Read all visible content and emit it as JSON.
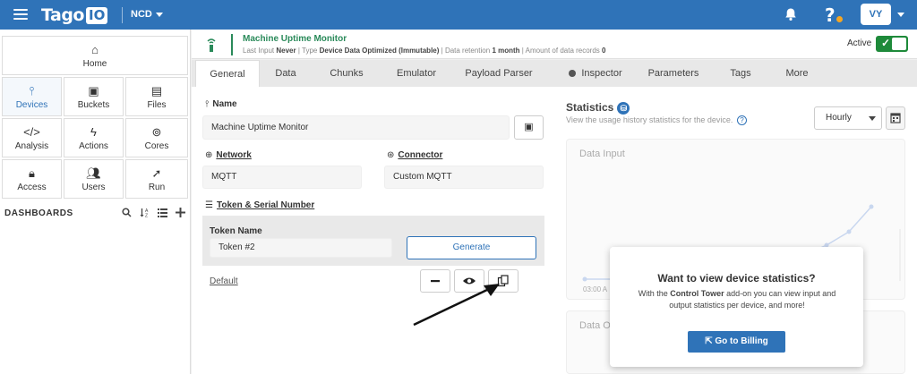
{
  "topbar": {
    "logo_text": "Tago",
    "logo_io": "IO",
    "account": "NCD",
    "help": "?",
    "avatar": "VY"
  },
  "sidebar": {
    "tiles": [
      {
        "label": "Home",
        "icon": "home-icon",
        "glyph": "⌂"
      },
      {
        "label": "Devices",
        "icon": "device-icon",
        "glyph": "⫯"
      },
      {
        "label": "Buckets",
        "icon": "bucket-icon",
        "glyph": "▣"
      },
      {
        "label": "Files",
        "icon": "file-icon",
        "glyph": "▤"
      },
      {
        "label": "Analysis",
        "icon": "code-icon",
        "glyph": "</>"
      },
      {
        "label": "Actions",
        "icon": "bolt-icon",
        "glyph": "ϟ"
      },
      {
        "label": "Cores",
        "icon": "cores-icon",
        "glyph": "⊚"
      },
      {
        "label": "Access",
        "icon": "lock-icon",
        "glyph": "🔒︎"
      },
      {
        "label": "Users",
        "icon": "users-icon",
        "glyph": "👥︎"
      },
      {
        "label": "Run",
        "icon": "rocket-icon",
        "glyph": "➚"
      }
    ],
    "dashboards_label": "DASHBOARDS"
  },
  "device": {
    "title": "Machine Uptime Monitor",
    "last_input_label": "Last Input",
    "last_input_value": "Never",
    "type_label": "Type",
    "type_value": "Device Data Optimized (Immutable)",
    "retention_label": "Data retention",
    "retention_value": "1 month",
    "records_label": "Amount of data records",
    "records_value": "0",
    "active_label": "Active",
    "active": true
  },
  "tabs": [
    "General",
    "Data",
    "Chunks",
    "Emulator",
    "Payload Parser",
    "Inspector",
    "Parameters",
    "Tags",
    "More"
  ],
  "general": {
    "name_label": "Name",
    "name_value": "Machine Uptime Monitor",
    "network_label": "Network",
    "network_value": "MQTT",
    "connector_label": "Connector",
    "connector_value": "Custom MQTT",
    "token_section_label": "Token & Serial Number",
    "token_name_label": "Token Name",
    "token_name_value": "Token #2",
    "generate_label": "Generate",
    "default_label": "Default"
  },
  "statistics": {
    "title": "Statistics",
    "subtitle": "View the usage history statistics for the device.",
    "period": "Hourly",
    "card1_title": "Data Input",
    "card1_axis_label": "03:00 A",
    "card2_title": "Data O"
  },
  "popup": {
    "title": "Want to view device statistics?",
    "body_prefix": "With the",
    "body_bold": "Control Tower",
    "body_suffix": "add-on you can view input and output statistics per device, and more!",
    "button_label": "Go to Billing"
  },
  "colors": {
    "brand": "#2f73b8",
    "device_green": "#2a8a5a",
    "active_toggle": "#1e8a3a"
  }
}
